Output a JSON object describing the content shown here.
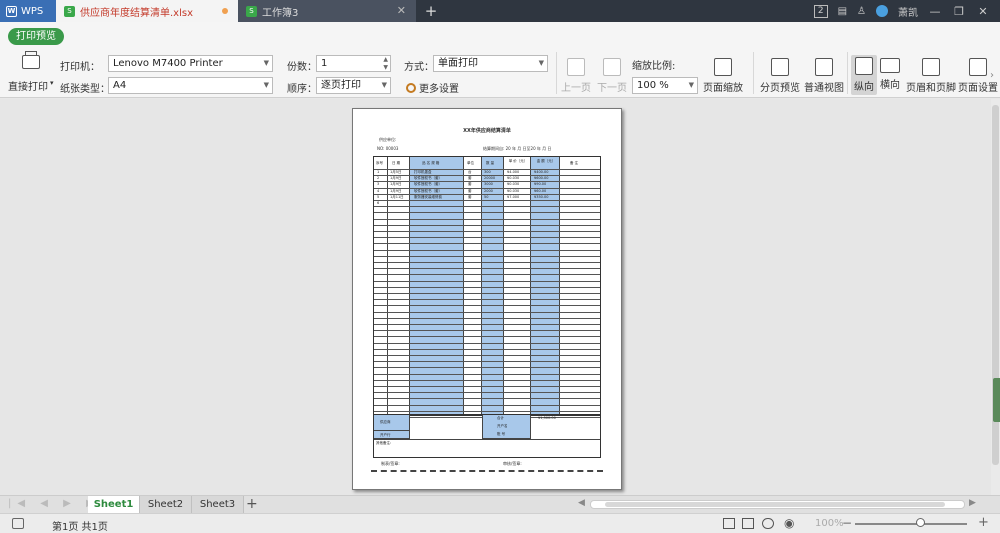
{
  "titlebar": {
    "app_name": "WPS",
    "tabs": [
      {
        "label": "供应商年度结算清单.xlsx"
      },
      {
        "label": "工作簿3"
      }
    ],
    "window_count": "2",
    "user_name": "萧凯"
  },
  "ribbon": {
    "print_preview_label": "打印预览",
    "direct_print_label": "直接打印",
    "printer_label": "打印机：",
    "printer_value": "Lenovo M7400 Printer",
    "paper_label": "纸张类型：",
    "paper_value": "A4",
    "copies_label": "份数：",
    "copies_value": "1",
    "order_label": "顺序：",
    "order_value": "逐页打印",
    "mode_label": "方式：",
    "mode_value": "单面打印",
    "more_settings_label": "更多设置",
    "prev_page_label": "上一页",
    "next_page_label": "下一页",
    "zoom_label": "缩放比例:",
    "zoom_value": "100 %",
    "page_zoom_label": "页面缩放",
    "page_break_label": "分页预览",
    "normal_view_label": "普通视图",
    "portrait_label": "纵向",
    "landscape_label": "横向",
    "header_footer_label": "页眉和页脚",
    "page_setup_label": "页面设置"
  },
  "page": {
    "title": "XX年供应商结算清单",
    "supplier_label": "供应单位:",
    "no_label": "NO: 00003",
    "period_label": "结算期间自: 20   年   月   日至20   年   月   日",
    "headers": [
      "序号",
      "日  期",
      "品  名  规  格",
      "单位",
      "数  量",
      "单  价（元）",
      "金  额（元）",
      "备  注"
    ],
    "rows": [
      [
        "1",
        "1月5日",
        "打印机墨盒",
        "台",
        "300",
        "¥4.000",
        "¥400.00"
      ],
      [
        "2",
        "1月9日",
        "软件授权书（套）",
        "套",
        "20000",
        "¥0.030",
        "¥600.00"
      ],
      [
        "3",
        "1月9日",
        "软件授权书（套）",
        "套",
        "3000",
        "¥0.030",
        "¥90.00"
      ],
      [
        "4",
        "1月9日",
        "软件授权书（套）",
        "套",
        "2000",
        "¥0.030",
        "¥60.00"
      ],
      [
        "5",
        "1月11日",
        "服务器安装维修费",
        "套",
        "50",
        "¥7.000",
        "¥350.00"
      ],
      [
        "6",
        "",
        "",
        "",
        "",
        "",
        ""
      ]
    ],
    "footer": {
      "label_a": "供应商",
      "label_b": "开户行",
      "total_label": "合计",
      "total_value": "¥1,500.00",
      "label_c": "开户名",
      "label_d": "账  号",
      "remark_label": "其他备注:",
      "sign_left": "制表/签章:",
      "sign_right": "审核/签章:"
    }
  },
  "sheets": [
    "Sheet1",
    "Sheet2",
    "Sheet3"
  ],
  "status": {
    "page_info": "第1页 共1页",
    "zoom": "100%"
  }
}
